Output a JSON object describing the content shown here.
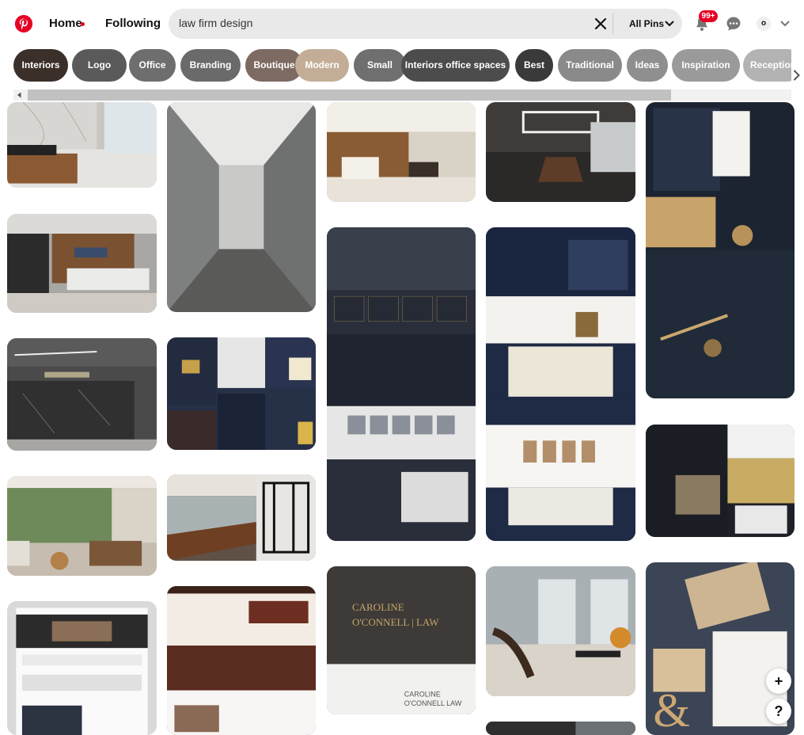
{
  "header": {
    "home_label": "Home",
    "following_label": "Following",
    "search": {
      "value": "law firm design",
      "filter_label": "All Pins"
    },
    "notification_count": "99+",
    "avatar_initial": "o"
  },
  "chips": [
    {
      "label": "Interiors",
      "color": "#3b2f29"
    },
    {
      "label": "Logo",
      "color": "#5a5a5a"
    },
    {
      "label": "Office",
      "color": "#6e6e6e"
    },
    {
      "label": "Branding",
      "color": "#6a6a6a"
    },
    {
      "label": "Boutique",
      "color": "#7d6a62"
    },
    {
      "label": "Modern",
      "color": "#c4ad96"
    },
    {
      "label": "Small",
      "color": "#6f6f6f"
    },
    {
      "label": "Interiors office spaces",
      "color": "#4c4c4c"
    },
    {
      "label": "Best",
      "color": "#3a3a3a"
    },
    {
      "label": "Traditional",
      "color": "#8a8a8a"
    },
    {
      "label": "Ideas",
      "color": "#8f8f8f"
    },
    {
      "label": "Inspiration",
      "color": "#9a9a9a"
    },
    {
      "label": "Reception",
      "color": "#b3b3b3"
    }
  ],
  "pins": [
    {
      "theme": "reception-wood",
      "color": "#c9c6c1"
    },
    {
      "theme": "glass-corridor",
      "color": "#9a9a98"
    },
    {
      "theme": "wood-reception-lit",
      "color": "#b08a62"
    },
    {
      "theme": "boardroom-dark",
      "color": "#3e3b38"
    },
    {
      "theme": "stationery-navy-gold",
      "color": "#1c2431"
    },
    {
      "theme": "mccathern-reception",
      "color": "#a9a7a4"
    },
    {
      "theme": "website-experience-trust-results",
      "color": "#2a2e3a"
    },
    {
      "theme": "website-navy-statues",
      "color": "#1f2a44"
    },
    {
      "theme": "marble-reception-dark",
      "color": "#4a4a4a"
    },
    {
      "theme": "website-collage-dark",
      "color": "#263047"
    },
    {
      "theme": "website-dark-gold",
      "color": "#1e2027"
    },
    {
      "theme": "lounge-garden",
      "color": "#b6aa98"
    },
    {
      "theme": "conference-glass-black",
      "color": "#5f5146"
    },
    {
      "theme": "caroline-oconnell-logo",
      "color": "#3f3c3a"
    },
    {
      "theme": "office-door-chair",
      "color": "#6b5b4c"
    },
    {
      "theme": "ampersand-stationery",
      "color": "#3c4556"
    },
    {
      "theme": "website-the-lawyer",
      "color": "#d9d9d9"
    },
    {
      "theme": "website-law-agency-gavel",
      "color": "#5a2b1f"
    },
    {
      "theme": "dark-interior-partial",
      "color": "#343434"
    }
  ],
  "fab": {
    "plus_label": "+",
    "help_label": "?"
  }
}
